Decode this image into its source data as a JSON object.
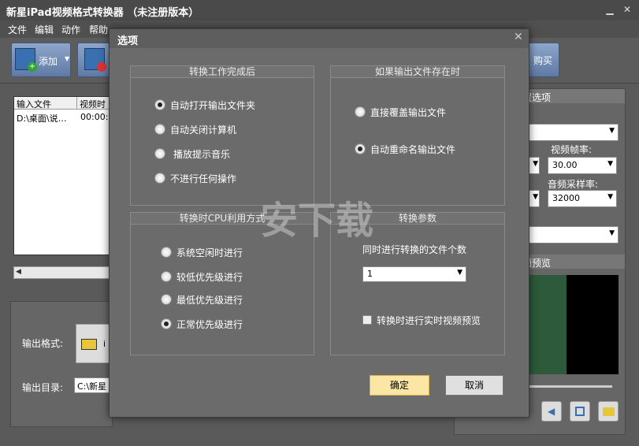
{
  "app": {
    "title": "新星iPad视频格式转换器 （未注册版本）"
  },
  "menu": [
    "文件",
    "编辑",
    "动作",
    "帮助"
  ],
  "toolbar": {
    "add_label": "添加",
    "buy_label": "购买"
  },
  "filelist": {
    "headers": [
      "输入文件",
      "视频时"
    ],
    "rows": [
      [
        "D:\\桌面\\说…",
        "00:00:("
      ]
    ]
  },
  "bottom": {
    "format_label": "输出格式:",
    "format_value": "i",
    "dir_label": "输出目录:",
    "dir_value": "C:\\新星"
  },
  "right": {
    "section_title": "置选项",
    "fps_label": "视频帧率:",
    "fps_value": "30.00",
    "sample_label": "音频采样率:",
    "sample_value": "32000",
    "preview_title": "频预览"
  },
  "dialog": {
    "title": "选项",
    "group_finish": {
      "title": "转换工作完成后",
      "options": [
        "自动打开输出文件夹",
        "自动关闭计算机",
        "播放提示音乐",
        "不进行任何操作"
      ],
      "selected": 0
    },
    "group_exists": {
      "title": "如果输出文件存在时",
      "options": [
        "直接覆盖输出文件",
        "自动重命名输出文件"
      ],
      "selected": 1
    },
    "group_cpu": {
      "title": "转换时CPU利用方式",
      "options": [
        "系统空闲时进行",
        "较低优先级进行",
        "最低优先级进行",
        "正常优先级进行"
      ],
      "selected": 3
    },
    "group_params": {
      "title": "转换参数",
      "count_label": "同时进行转换的文件个数",
      "count_value": "1",
      "preview_label": "转换时进行实时视频预览"
    },
    "ok_label": "确定",
    "cancel_label": "取消"
  },
  "watermark": "安下载"
}
